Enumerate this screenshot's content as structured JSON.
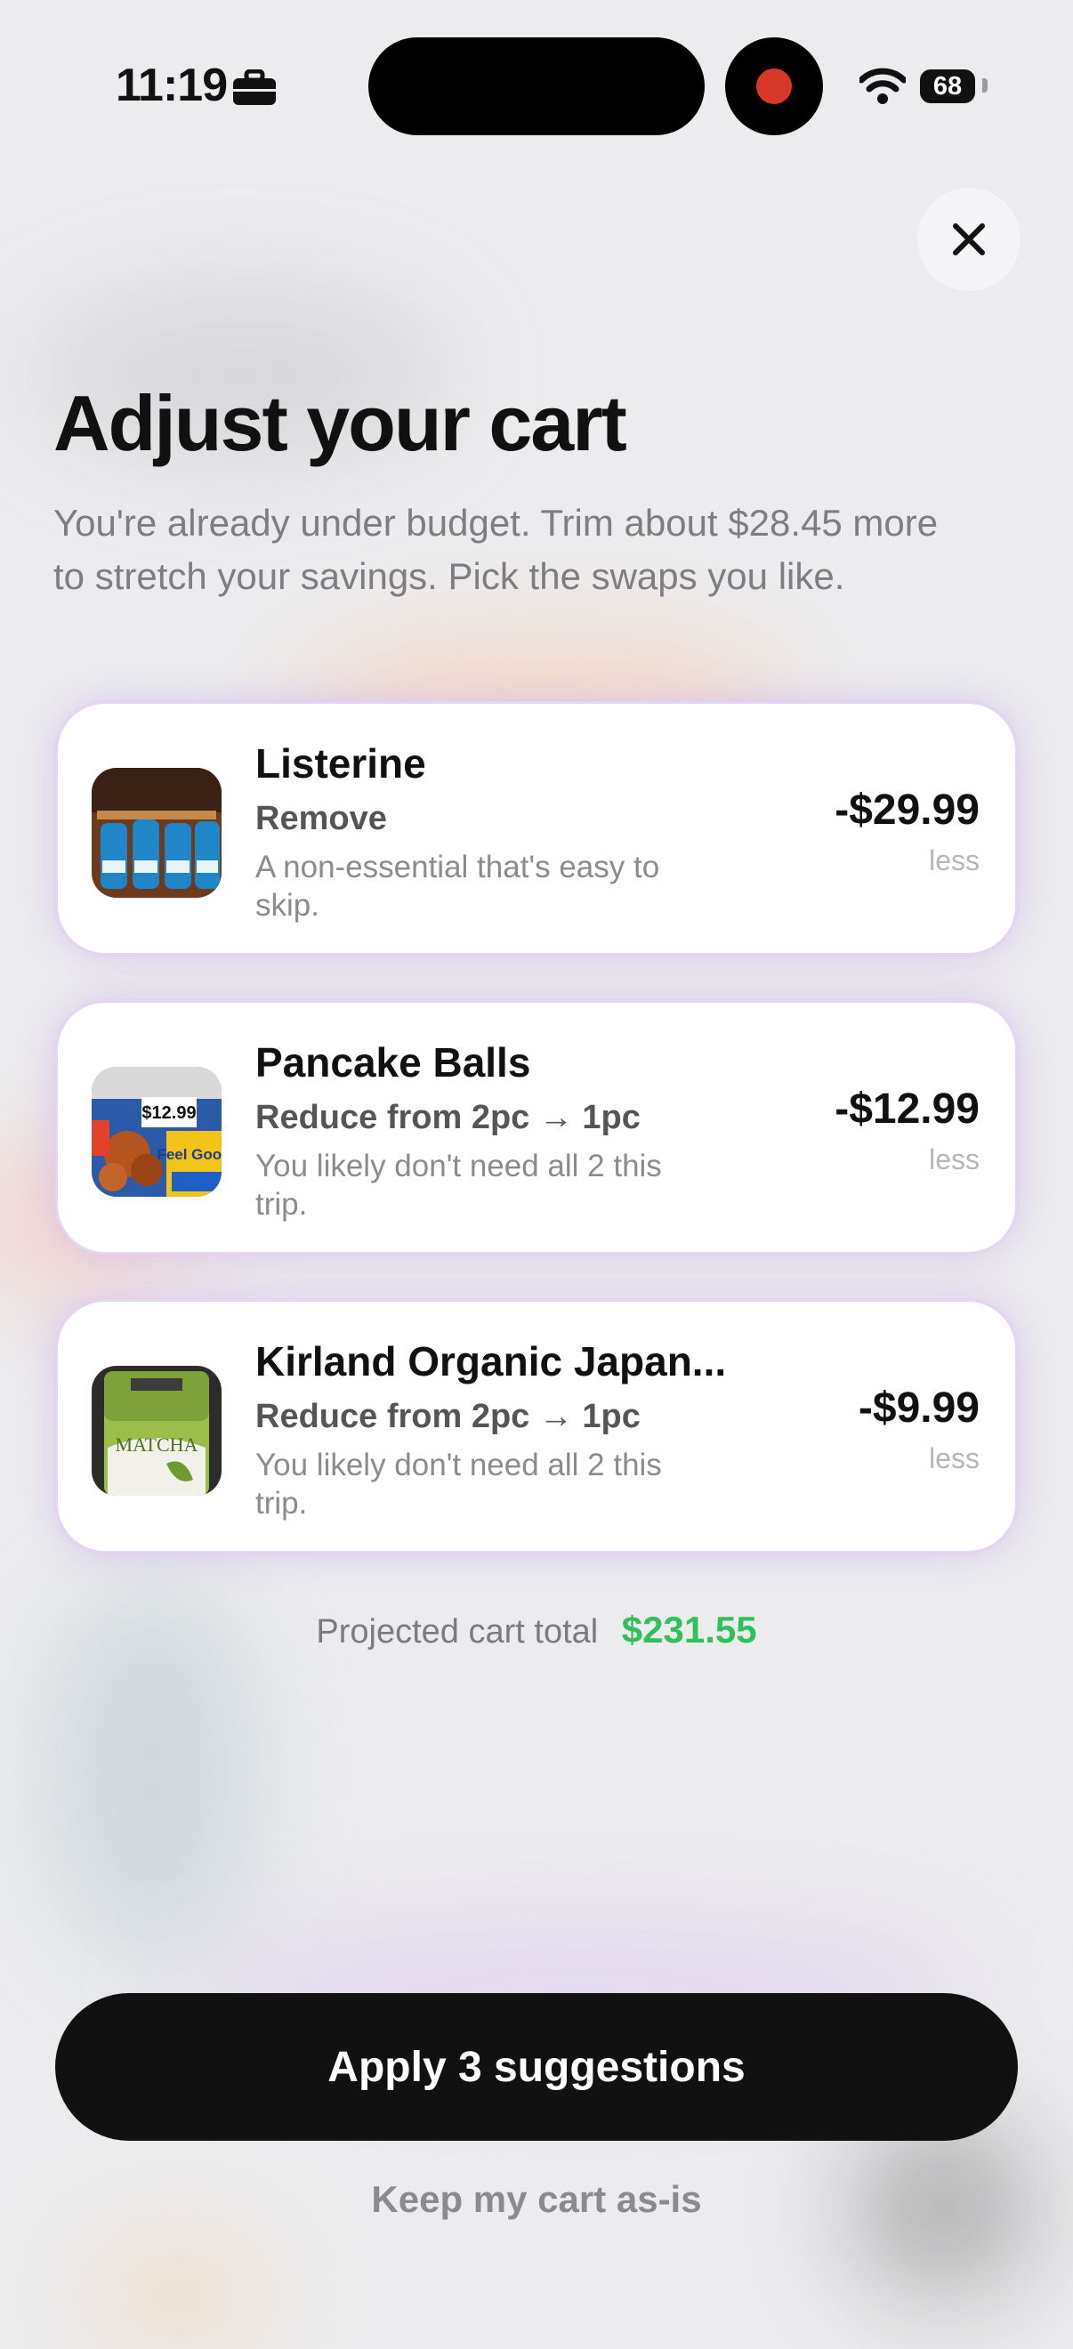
{
  "status_bar": {
    "time": "11:19",
    "battery": "68"
  },
  "header": {
    "title": "Adjust your cart",
    "subtitle": "You're already under budget. Trim about $28.45 more to stretch your savings. Pick the swaps you like."
  },
  "suggestions": [
    {
      "name": "Listerine",
      "action": "Remove",
      "reason": "A non-essential that's easy to skip.",
      "price": "-$29.99",
      "less": "less"
    },
    {
      "name": "Pancake Balls",
      "action": "Reduce from 2pc → 1pc",
      "reason": "You likely don't need all 2 this trip.",
      "price": "-$12.99",
      "less": "less",
      "image_price_tag": "$12.99",
      "image_text": "Feel Good"
    },
    {
      "name": "Kirland Organic Japan...",
      "action": "Reduce from 2pc → 1pc",
      "reason": "You likely don't need all 2 this trip.",
      "price": "-$9.99",
      "less": "less",
      "image_text": "MATCHA"
    }
  ],
  "projected": {
    "label": "Projected cart total",
    "amount": "$231.55"
  },
  "buttons": {
    "apply": "Apply 3 suggestions",
    "keep": "Keep my cart as-is"
  },
  "colors": {
    "accent_green": "#2fbf5b",
    "primary_button": "#111111",
    "record_red": "#d7382a"
  }
}
